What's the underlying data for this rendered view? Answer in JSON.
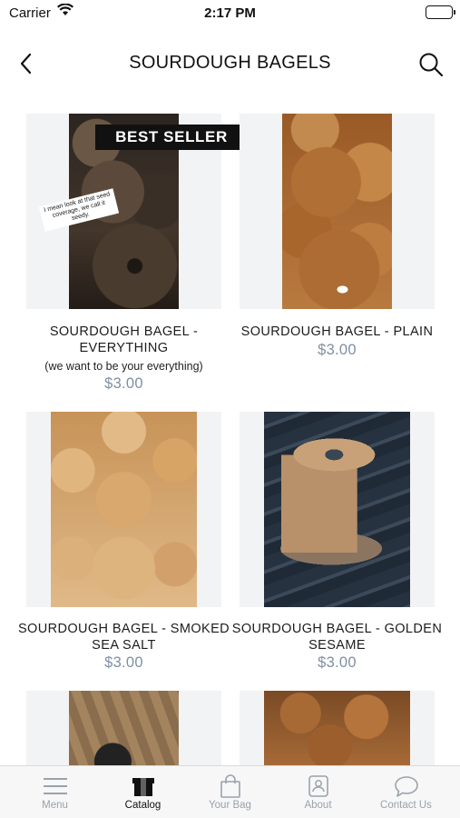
{
  "status_bar": {
    "carrier": "Carrier",
    "time": "2:17 PM",
    "battery_level": 1.0
  },
  "header": {
    "title": "SOURDOUGH BAGELS",
    "back_icon": "chevron-left-icon",
    "search_icon": "search-icon"
  },
  "products": [
    {
      "badge": "BEST SELLER",
      "sticker_text": "I mean look at that seed coverage, we call it seedy.",
      "name": "SOURDOUGH BAGEL - EVERYTHING",
      "description": "(we want to be your everything)",
      "price": "$3.00"
    },
    {
      "name": "SOURDOUGH BAGEL - PLAIN",
      "price": "$3.00"
    },
    {
      "name": "SOURDOUGH BAGEL - SMOKED SEA SALT",
      "price": "$3.00"
    },
    {
      "name": "SOURDOUGH BAGEL - GOLDEN SESAME",
      "price": "$3.00"
    },
    {},
    {}
  ],
  "tab_bar": {
    "active": "Catalog",
    "tabs": [
      {
        "label": "Menu",
        "icon": "hamburger-menu-icon"
      },
      {
        "label": "Catalog",
        "icon": "box-icon"
      },
      {
        "label": "Your Bag",
        "icon": "shopping-bag-icon"
      },
      {
        "label": "About",
        "icon": "contact-card-icon"
      },
      {
        "label": "Contact Us",
        "icon": "chat-bubble-icon"
      }
    ]
  },
  "colors": {
    "price": "#7f8fa4",
    "tab_inactive": "#9aa2ac",
    "tab_active": "#111111",
    "badge_bg": "#111111"
  }
}
